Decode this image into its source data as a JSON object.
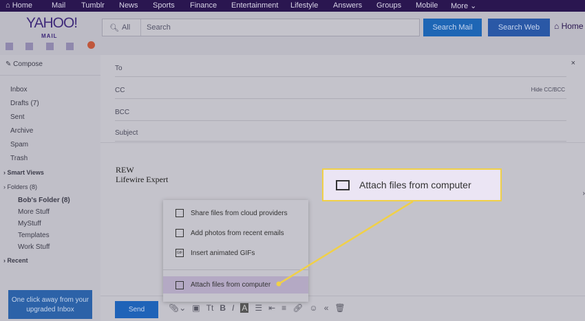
{
  "nav": [
    "Home",
    "Mail",
    "Tumblr",
    "News",
    "Sports",
    "Finance",
    "Entertainment",
    "Lifestyle",
    "Answers",
    "Groups",
    "Mobile",
    "More ⌄"
  ],
  "logo": {
    "text": "YAHOO!",
    "sub": "MAIL"
  },
  "search": {
    "scope": "All",
    "placeholder": "Search",
    "search_mail": "Search Mail",
    "search_web": "Search Web",
    "home": "Home"
  },
  "sidebar": {
    "compose": "Compose",
    "folders": [
      "Inbox",
      "Drafts (7)",
      "Sent",
      "Archive",
      "Spam",
      "Trash"
    ],
    "smart_views": "Smart Views",
    "folders_label": "Folders (8)",
    "subfolders": [
      "Bob's Folder  (8)",
      "More Stuff",
      "MyStuff",
      "Templates",
      "Work Stuff"
    ],
    "recent": "Recent",
    "upgrade": "One click away from your upgraded Inbox"
  },
  "compose": {
    "to": "To",
    "cc": "CC",
    "bcc": "BCC",
    "subject": "Subject",
    "hide_cc": "Hide CC/BCC",
    "close": "×",
    "body_line1": "REW",
    "body_line2": "Lifewire Expert",
    "send": "Send"
  },
  "attach_menu": [
    "Share files from cloud providers",
    "Add photos from recent emails",
    "Insert animated GIFs",
    "Attach files from computer"
  ],
  "callout": "Attach files from computer",
  "colors": {
    "nav": "#2a1650",
    "accent": "#1f63b8",
    "highlight": "#f0d048"
  }
}
